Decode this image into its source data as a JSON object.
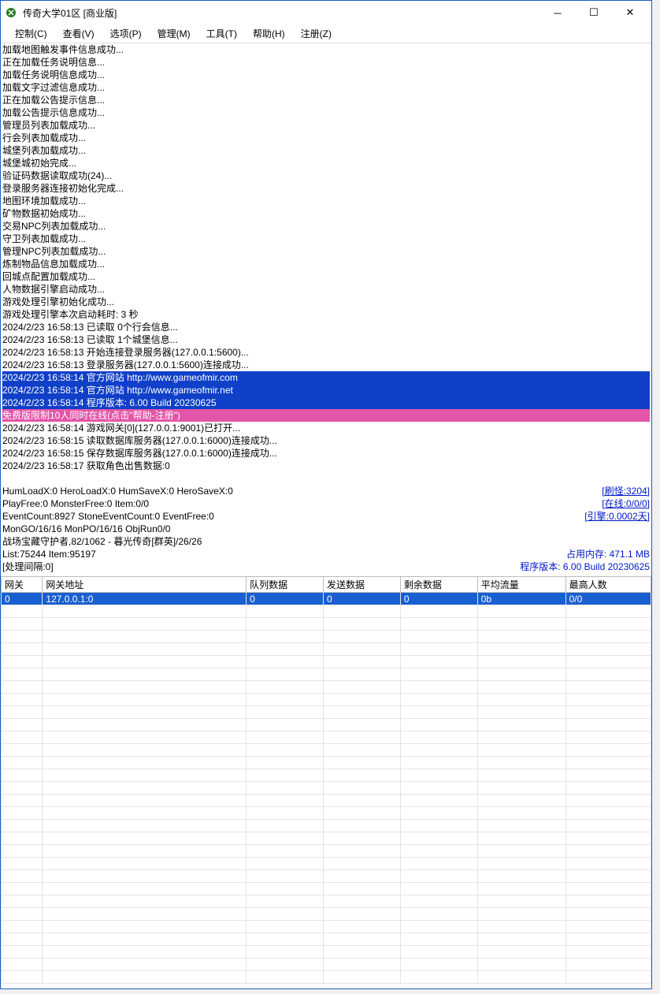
{
  "titlebar": {
    "title": "传奇大学01区 [商业版]"
  },
  "menu": {
    "items": [
      "控制(C)",
      "查看(V)",
      "选项(P)",
      "管理(M)",
      "工具(T)",
      "帮助(H)",
      "注册(Z)"
    ]
  },
  "log": [
    {
      "t": "加载地图触发事件信息成功..."
    },
    {
      "t": "正在加载任务说明信息..."
    },
    {
      "t": "加载任务说明信息成功..."
    },
    {
      "t": "加载文字过滤信息成功..."
    },
    {
      "t": "正在加载公告提示信息..."
    },
    {
      "t": "加载公告提示信息成功..."
    },
    {
      "t": "管理员列表加载成功..."
    },
    {
      "t": "行会列表加载成功..."
    },
    {
      "t": "城堡列表加载成功..."
    },
    {
      "t": "城堡城初始完成..."
    },
    {
      "t": "验证码数据读取成功(24)..."
    },
    {
      "t": "登录服务器连接初始化完成..."
    },
    {
      "t": "地图环境加载成功..."
    },
    {
      "t": "矿物数据初始成功..."
    },
    {
      "t": "交易NPC列表加载成功..."
    },
    {
      "t": "守卫列表加载成功..."
    },
    {
      "t": "管理NPC列表加载成功..."
    },
    {
      "t": "炼制物品信息加载成功..."
    },
    {
      "t": "回城点配置加载成功..."
    },
    {
      "t": "人物数据引擎启动成功..."
    },
    {
      "t": "游戏处理引擎初始化成功..."
    },
    {
      "t": "游戏处理引擎本次启动耗时: 3 秒"
    },
    {
      "t": "2024/2/23 16:58:13 已读取 0个行会信息..."
    },
    {
      "t": "2024/2/23 16:58:13 已读取 1个城堡信息..."
    },
    {
      "t": "2024/2/23 16:58:13 开始连接登录服务器(127.0.0.1:5600)..."
    },
    {
      "t": "2024/2/23 16:58:13 登录服务器(127.0.0.1:5600)连接成功..."
    },
    {
      "t": "2024/2/23 16:58:14 官方网站 http://www.gameofmir.com",
      "c": "blue"
    },
    {
      "t": "2024/2/23 16:58:14 官方网站 http://www.gameofmir.net",
      "c": "blue"
    },
    {
      "t": "2024/2/23 16:58:14 程序版本: 6.00 Build 20230625",
      "c": "blue"
    },
    {
      "t": "免费版限制10人同时在线(点击\"帮助-注册\")",
      "c": "pink"
    },
    {
      "t": "2024/2/23 16:58:14 游戏网关[0](127.0.0.1:9001)已打开..."
    },
    {
      "t": "2024/2/23 16:58:15 读取数据库服务器(127.0.0.1:6000)连接成功..."
    },
    {
      "t": "2024/2/23 16:58:15 保存数据库服务器(127.0.0.1:6000)连接成功..."
    },
    {
      "t": "2024/2/23 16:58:17 获取角色出售数据:0"
    }
  ],
  "stats": {
    "l1_left": "HumLoadX:0 HeroLoadX:0 HumSaveX:0 HeroSaveX:0",
    "l1_right": "[刷怪:3204]",
    "l2_left": "PlayFree:0 MonsterFree:0 Item:0/0",
    "l2_right": "[在线:0/0/0]",
    "l3_left": "EventCount:8927 StoneEventCount:0 EventFree:0",
    "l3_right": "[引擎:0.0002天]",
    "l4": "MonGO/16/16 MonPO/16/16 ObjRun0/0",
    "l5": "战场宝藏守护者,82/1062 - 暮光传奇[群英]/26/26",
    "l6_left": "List:75244 Item:95197",
    "l6_right": "占用内存: 471.1 MB",
    "l7_left": "[处理间隔:0]",
    "l7_right": "程序版本: 6.00 Build 20230625"
  },
  "table": {
    "headers": [
      "网关",
      "网关地址",
      "队列数据",
      "发送数据",
      "剩余数据",
      "平均流量",
      "最高人数"
    ],
    "rows": [
      {
        "sel": true,
        "c": [
          "0",
          "127.0.0.1:0",
          "0",
          "0",
          "0",
          "0b",
          "0/0"
        ]
      }
    ],
    "empty_rows": 30
  }
}
